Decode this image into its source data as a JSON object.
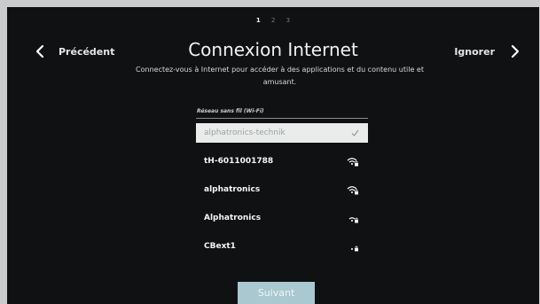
{
  "steps": [
    "1",
    "2",
    "3"
  ],
  "nav": {
    "back_label": "Précédent",
    "skip_label": "Ignorer"
  },
  "title": "Connexion Internet",
  "subtitle": "Connectez-vous à Internet pour accéder à des applications et du contenu utile et amusant.",
  "wifi": {
    "header": "Réseau sans fil (Wi-Fi)",
    "selected": {
      "name": "alphatronics-technik",
      "icon": "check-icon"
    },
    "networks": [
      {
        "name": "tH-6011001788",
        "icon": "wifi-secured-icon",
        "signal": 4
      },
      {
        "name": "alphatronics",
        "icon": "wifi-secured-icon",
        "signal": 4
      },
      {
        "name": "Alphatronics",
        "icon": "wifi-secured-icon",
        "signal": 3
      },
      {
        "name": "CBext1",
        "icon": "wifi-secured-icon",
        "signal": 2
      }
    ]
  },
  "next_label": "Suivant",
  "colors": {
    "background": "#0f1113",
    "selected_row": "#e9ecea",
    "next_button": "#aac8cf"
  }
}
